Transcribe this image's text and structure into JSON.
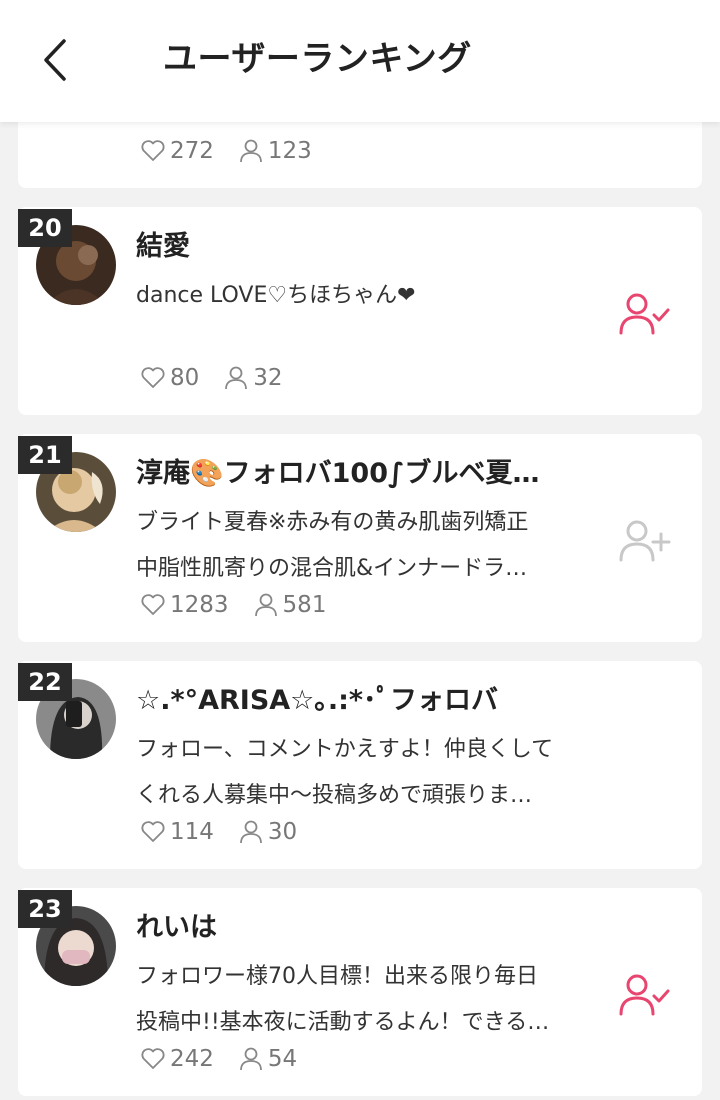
{
  "header": {
    "title": "ユーザーランキング"
  },
  "colors": {
    "accent": "#e8456f",
    "inactive": "#c8c8c8",
    "badge": "#2b2b2b"
  },
  "partial_card": {
    "likes": "272",
    "followers": "123"
  },
  "users": [
    {
      "rank": "20",
      "name": "結愛",
      "bio": [
        "dance LOVE♡ちほちゃん❤"
      ],
      "likes": "80",
      "followers": "32",
      "following": true
    },
    {
      "rank": "21",
      "name": "淳庵🎨フォロバ100∫ブルベ夏…",
      "bio": [
        "ブライト夏春※赤み有の黄み肌歯列矯正",
        "中脂性肌寄りの混合肌&インナードラ…"
      ],
      "likes": "1283",
      "followers": "581",
      "following": false
    },
    {
      "rank": "22",
      "name": "☆.*°ARISA☆｡.:*･ﾟフォロバ",
      "bio": [
        "フォロー、コメントかえすよ！仲良くして",
        "くれる人募集中〜投稿多めで頑張りま…"
      ],
      "likes": "114",
      "followers": "30",
      "following": false
    },
    {
      "rank": "23",
      "name": "れいは",
      "bio": [
        "フォロワー様70人目標！出来る限り毎日",
        "投稿中!!基本夜に活動するよん！できる…"
      ],
      "likes": "242",
      "followers": "54",
      "following": true
    }
  ]
}
